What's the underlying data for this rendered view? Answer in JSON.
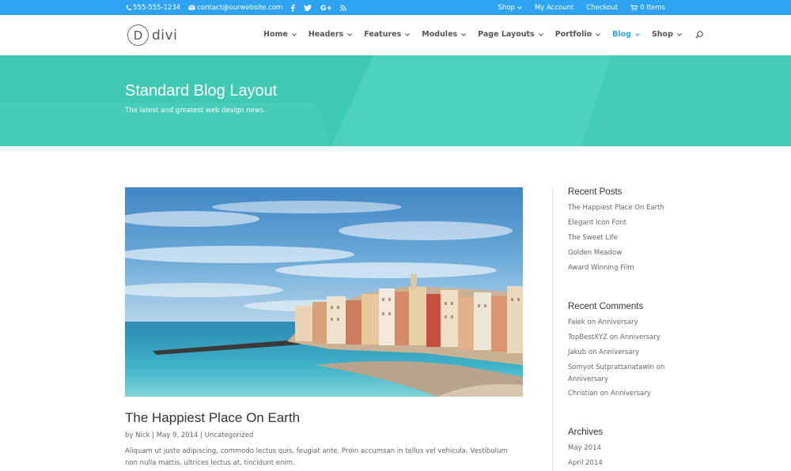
{
  "topbar": {
    "phone": "555-555-1234",
    "email": "contact@ourwebsite.com",
    "social": [
      "facebook-icon",
      "twitter-icon",
      "google-plus-icon",
      "rss-icon"
    ],
    "links": {
      "shop": "Shop",
      "account": "My Account",
      "checkout": "Checkout",
      "cart": "0 Items"
    }
  },
  "header": {
    "logo_mark": "D",
    "logo_text": "divi",
    "nav": [
      {
        "label": "Home"
      },
      {
        "label": "Headers"
      },
      {
        "label": "Features"
      },
      {
        "label": "Modules"
      },
      {
        "label": "Page Layouts"
      },
      {
        "label": "Portfolio"
      },
      {
        "label": "Blog",
        "active": true
      },
      {
        "label": "Shop"
      }
    ]
  },
  "hero": {
    "title": "Standard Blog Layout",
    "subtitle": "The latest and greatest web design news."
  },
  "post": {
    "title": "The Happiest Place On Earth",
    "author_prefix": "by ",
    "author": "Nick",
    "sep": " | ",
    "date": "May 9, 2014",
    "category": "Uncategorized",
    "excerpt": "Aliquam ut justo adipiscing, commodo lectus quis, feugiat ante. Proin accumsan in tellus vel vehicula. Vestibulum non nulla mattis, ultrices lectus at, tincidunt enim."
  },
  "sidebar": {
    "recent_posts": {
      "title": "Recent Posts",
      "items": [
        "The Happiest Place On Earth",
        "Elegant Icon Font",
        "The Sweet Life",
        "Golden Meadow",
        "Award Winning Film"
      ]
    },
    "recent_comments": {
      "title": "Recent Comments",
      "items": [
        {
          "author": "Faiek",
          "on": " on ",
          "post": "Anniversary"
        },
        {
          "author": "TopBestXYZ",
          "on": " on ",
          "post": "Anniversary"
        },
        {
          "author": "Jakub",
          "on": " on ",
          "post": "Anniversary"
        },
        {
          "author": "Somyot Sutprattanatawin",
          "on": " on ",
          "post": "Anniversary"
        },
        {
          "author": "Christian",
          "on": " on ",
          "post": "Anniversary"
        }
      ]
    },
    "archives": {
      "title": "Archives",
      "items": [
        "May 2014",
        "April 2014"
      ]
    }
  },
  "colors": {
    "accent": "#2ea3f2",
    "hero": "#3fc9b4"
  }
}
